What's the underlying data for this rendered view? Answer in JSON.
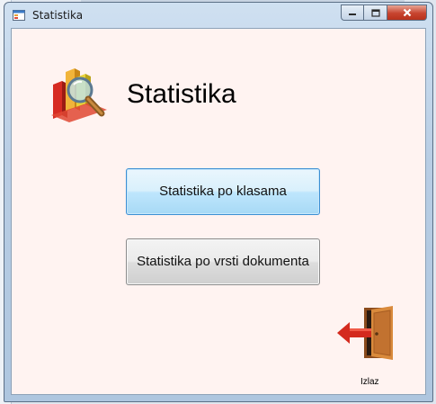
{
  "window": {
    "title": "Statistika"
  },
  "main": {
    "heading": "Statistika",
    "buttons": [
      {
        "label": "Statistika po klasama"
      },
      {
        "label": "Statistika po vrsti dokumenta"
      }
    ],
    "exit_label": "Izlaz"
  },
  "icons": {
    "logo": "statistics-magnifier-icon",
    "exit": "exit-door-icon",
    "app": "form-icon"
  },
  "colors": {
    "client_bg": "#fff3f1",
    "close_button": "#c7442f",
    "focused_border": "#3c8fd3"
  }
}
